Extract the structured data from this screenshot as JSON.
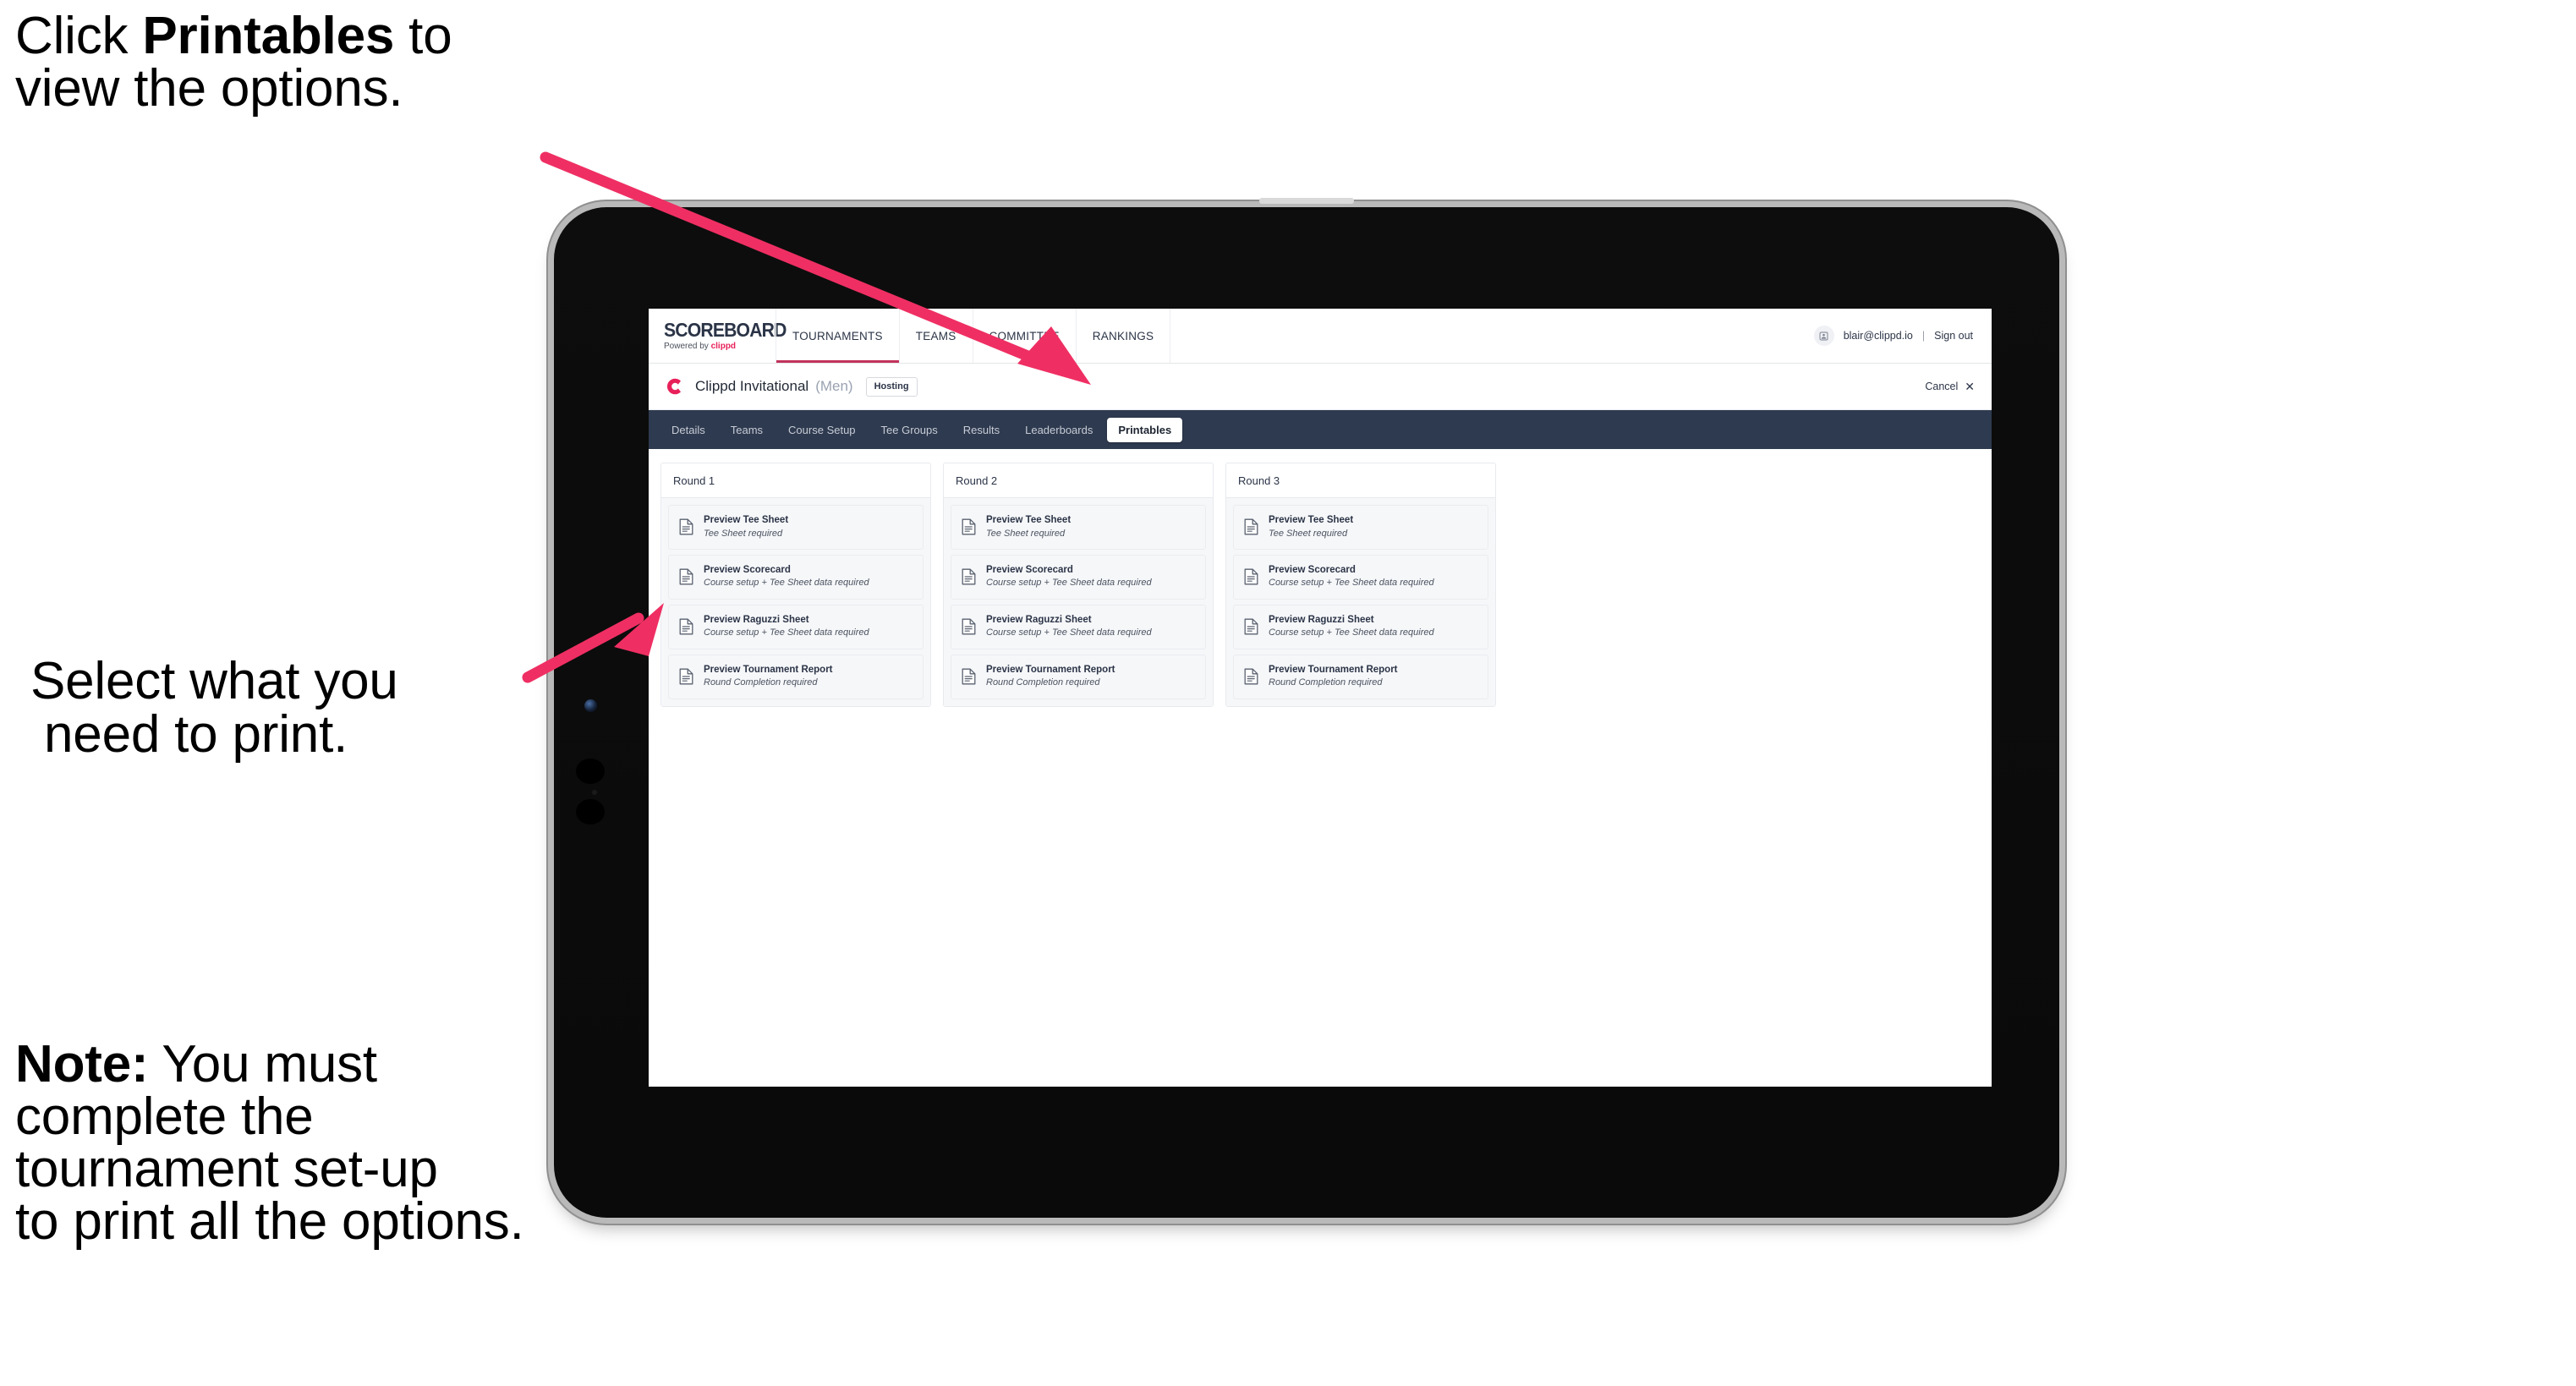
{
  "annotations": {
    "top": {
      "prefix": "Click ",
      "bold": "Printables",
      "suffix": " to",
      "line2": "view the options."
    },
    "middle": {
      "line1": "Select what you",
      "line2": "need to print."
    },
    "note": {
      "bold": "Note:",
      "line1_rest": " You must",
      "line2": "complete the",
      "line3": "tournament set-up",
      "line4": "to print all the options."
    }
  },
  "app": {
    "brand": {
      "title": "SCOREBOARD",
      "powered_prefix": "Powered by ",
      "powered_brand": "clippd"
    },
    "main_nav": [
      {
        "label": "TOURNAMENTS",
        "active": true
      },
      {
        "label": "TEAMS",
        "active": false
      },
      {
        "label": "COMMITTEE",
        "active": false
      },
      {
        "label": "RANKINGS",
        "active": false
      }
    ],
    "account": {
      "avatar_icon": "user-avatar-icon",
      "email": "blair@clippd.io",
      "separator": "|",
      "sign_out_label": "Sign out"
    },
    "tournament": {
      "logo_icon": "clippd-c-logo-icon",
      "name": "Clippd Invitational",
      "gender": "(Men)",
      "status_badge": "Hosting",
      "cancel_label": "Cancel",
      "cancel_icon": "close-icon"
    },
    "tabs": [
      {
        "label": "Details",
        "active": false
      },
      {
        "label": "Teams",
        "active": false
      },
      {
        "label": "Course Setup",
        "active": false
      },
      {
        "label": "Tee Groups",
        "active": false
      },
      {
        "label": "Results",
        "active": false
      },
      {
        "label": "Leaderboards",
        "active": false
      },
      {
        "label": "Printables",
        "active": true
      }
    ],
    "rounds": [
      {
        "title": "Round 1",
        "items": [
          {
            "icon": "document-icon",
            "title": "Preview Tee Sheet",
            "subtitle": "Tee Sheet required"
          },
          {
            "icon": "document-icon",
            "title": "Preview Scorecard",
            "subtitle": "Course setup + Tee Sheet data required"
          },
          {
            "icon": "document-icon",
            "title": "Preview Raguzzi Sheet",
            "subtitle": "Course setup + Tee Sheet data required"
          },
          {
            "icon": "document-icon",
            "title": "Preview Tournament Report",
            "subtitle": "Round Completion required"
          }
        ]
      },
      {
        "title": "Round 2",
        "items": [
          {
            "icon": "document-icon",
            "title": "Preview Tee Sheet",
            "subtitle": "Tee Sheet required"
          },
          {
            "icon": "document-icon",
            "title": "Preview Scorecard",
            "subtitle": "Course setup + Tee Sheet data required"
          },
          {
            "icon": "document-icon",
            "title": "Preview Raguzzi Sheet",
            "subtitle": "Course setup + Tee Sheet data required"
          },
          {
            "icon": "document-icon",
            "title": "Preview Tournament Report",
            "subtitle": "Round Completion required"
          }
        ]
      },
      {
        "title": "Round 3",
        "items": [
          {
            "icon": "document-icon",
            "title": "Preview Tee Sheet",
            "subtitle": "Tee Sheet required"
          },
          {
            "icon": "document-icon",
            "title": "Preview Scorecard",
            "subtitle": "Course setup + Tee Sheet data required"
          },
          {
            "icon": "document-icon",
            "title": "Preview Raguzzi Sheet",
            "subtitle": "Course setup + Tee Sheet data required"
          },
          {
            "icon": "document-icon",
            "title": "Preview Tournament Report",
            "subtitle": "Round Completion required"
          }
        ]
      }
    ]
  },
  "device": {
    "type": "tablet",
    "camera_icon": "front-camera-icon",
    "button_icons": [
      "hardware-button-icon",
      "hardware-button-icon"
    ]
  },
  "colors": {
    "accent_pink": "#ef2f63",
    "brand_pink": "#e8205a",
    "tabbar_navy": "#2e3a4f",
    "nav_underline": "#c2335c",
    "panel_gray": "#f6f7f9"
  }
}
